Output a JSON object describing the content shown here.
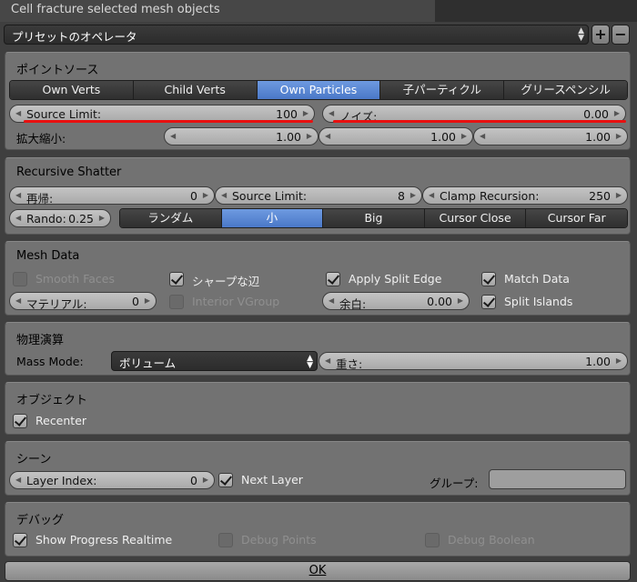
{
  "window": {
    "title": "Cell fracture selected mesh objects"
  },
  "preset": {
    "value": "プリセットのオペレータ",
    "add": "+",
    "remove": "−"
  },
  "point_source": {
    "title": "ポイントソース",
    "options": [
      "Own Verts",
      "Child Verts",
      "Own Particles",
      "子パーティクル",
      "グリースペンシル"
    ],
    "active": "Own Particles",
    "source_limit": {
      "label": "Source Limit:",
      "value": "100"
    },
    "noise": {
      "label": "ノイズ:",
      "value": "0.00"
    },
    "scale": {
      "label": "拡大縮小:",
      "x": "1.00",
      "y": "1.00",
      "z": "1.00"
    }
  },
  "recursive": {
    "title": "Recursive Shatter",
    "recursion": {
      "label": "再帰:",
      "value": "0"
    },
    "source_limit": {
      "label": "Source Limit:",
      "value": "8"
    },
    "clamp": {
      "label": "Clamp Recursion:",
      "value": "250"
    },
    "rando": {
      "label": "Rando:",
      "value": "0.25"
    },
    "options": [
      "ランダム",
      "小",
      "Big",
      "Cursor Close",
      "Cursor Far"
    ],
    "active": "小"
  },
  "mesh_data": {
    "title": "Mesh Data",
    "smooth_faces": {
      "label": "Smooth Faces",
      "checked": false
    },
    "sharp_edges": {
      "label": "シャープな辺",
      "checked": true
    },
    "apply_split_edge": {
      "label": "Apply Split Edge",
      "checked": true
    },
    "match_data": {
      "label": "Match Data",
      "checked": true
    },
    "material": {
      "label": "マテリアル:",
      "value": "0"
    },
    "interior_vgroup": {
      "label": "Interior VGroup",
      "checked": false
    },
    "margin": {
      "label": "余白:",
      "value": "0.00"
    },
    "split_islands": {
      "label": "Split Islands",
      "checked": true
    }
  },
  "physics": {
    "title": "物理演算",
    "mass_mode_label": "Mass Mode:",
    "mass_mode": "ボリューム",
    "weight": {
      "label": "重さ:",
      "value": "1.00"
    }
  },
  "object": {
    "title": "オブジェクト",
    "recenter": {
      "label": "Recenter",
      "checked": true
    }
  },
  "scene": {
    "title": "シーン",
    "layer_index": {
      "label": "Layer Index:",
      "value": "0"
    },
    "next_layer": {
      "label": "Next Layer",
      "checked": true
    },
    "group_label": "グループ:",
    "group_value": ""
  },
  "debug": {
    "title": "デバッグ",
    "show_progress": {
      "label": "Show Progress Realtime",
      "checked": true
    },
    "debug_points": {
      "label": "Debug Points",
      "checked": false
    },
    "debug_boolean": {
      "label": "Debug Boolean",
      "checked": false
    }
  },
  "ok": {
    "label": "OK"
  },
  "colors": {
    "active_blue": "#5b8ad6",
    "annotation_red": "#e81010",
    "panel_bg": "#727272"
  }
}
